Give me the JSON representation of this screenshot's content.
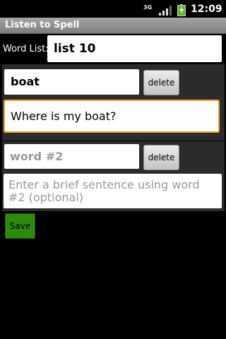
{
  "status_bar": {
    "network": "3G",
    "time": "12:09",
    "icons": [
      "signal-icon",
      "battery-charging-icon"
    ]
  },
  "title_bar": {
    "title": "Listen to Spell"
  },
  "word_list": {
    "label": "Word List:",
    "value": "list 10"
  },
  "entries": [
    {
      "word_value": "boat",
      "word_placeholder": "",
      "sentence_value": "Where is my boat?",
      "sentence_placeholder": "",
      "delete_label": "delete"
    },
    {
      "word_value": "",
      "word_placeholder": "word #2",
      "sentence_value": "",
      "sentence_placeholder": "Enter a brief sentence using word #2 (optional)",
      "delete_label": "delete"
    }
  ],
  "save_label": "Save",
  "colors": {
    "focus_border": "#f3a425",
    "save_button": "#2f8a12",
    "title_bar": "#8f8f8f"
  }
}
